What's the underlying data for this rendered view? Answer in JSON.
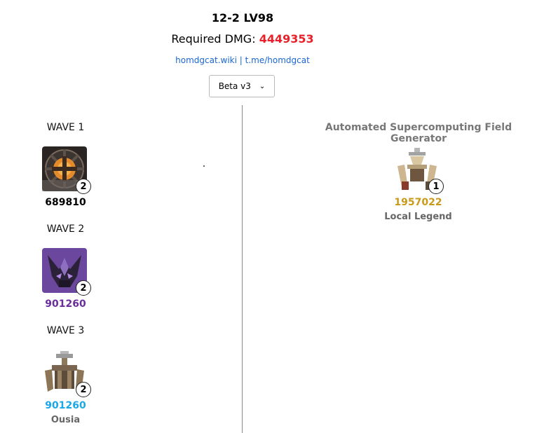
{
  "header": {
    "stage_title": "12-2 LV98",
    "required_label": "Required DMG:",
    "required_value": "4449353",
    "link_wiki": "homdgcat.wiki",
    "link_separator": "|",
    "link_tg": "t.me/homdgcat",
    "version_select": "Beta v3"
  },
  "waves": [
    {
      "label": "WAVE 1",
      "count": "2",
      "hp": "689810",
      "hp_color": "#000000",
      "name": ""
    },
    {
      "label": "WAVE 2",
      "count": "2",
      "hp": "901260",
      "hp_color": "#6a2e9c",
      "name": ""
    },
    {
      "label": "WAVE 3",
      "count": "2",
      "hp": "901260",
      "hp_color": "#1aa7e8",
      "name": "Ousia"
    }
  ],
  "boss": {
    "title": "Automated Supercomputing Field Generator",
    "count": "1",
    "hp": "1957022",
    "hp_color": "#c99a1a",
    "name": "Local Legend"
  },
  "colors": {
    "required": "#e8202a",
    "link": "#1a66d6",
    "divider": "#8a8a8a"
  }
}
